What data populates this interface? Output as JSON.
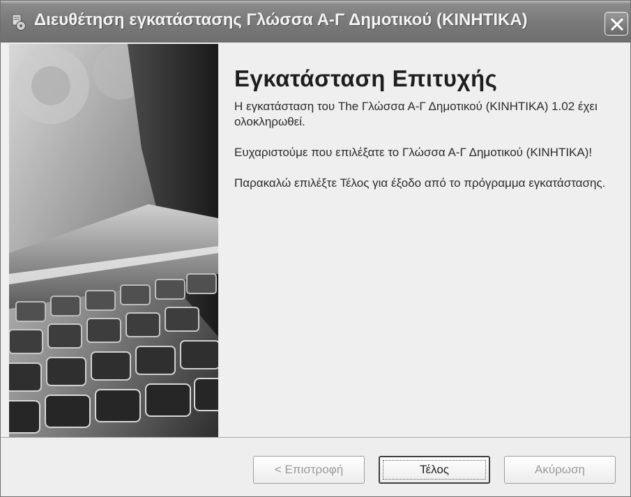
{
  "window": {
    "title": "Διευθέτηση εγκατάστασης Γλώσσα Α-Γ Δημοτικού (ΚΙΝΗΤΙΚΑ)"
  },
  "icons": {
    "app": "installer-icon",
    "close": "close-icon",
    "side_image": "laptop-keyboard-image"
  },
  "content": {
    "heading": "Εγκατάσταση Επιτυχής",
    "paragraphs": [
      "Η εγκατάσταση του The Γλώσσα Α-Γ Δημοτικού (ΚΙΝΗΤΙΚΑ) 1.02 έχει ολοκληρωθεί.",
      "Ευχαριστούμε που επιλέξατε το Γλώσσα Α-Γ Δημοτικού (ΚΙΝΗΤΙΚΑ)!",
      "Παρακαλώ επιλέξτε Τέλος για έξοδο από το πρόγραμμα εγκατάστασης."
    ]
  },
  "buttons": {
    "back": {
      "label": "< Επιστροφή",
      "enabled": false
    },
    "finish": {
      "label": "Τέλος",
      "enabled": true
    },
    "cancel": {
      "label": "Ακύρωση",
      "enabled": false
    }
  }
}
